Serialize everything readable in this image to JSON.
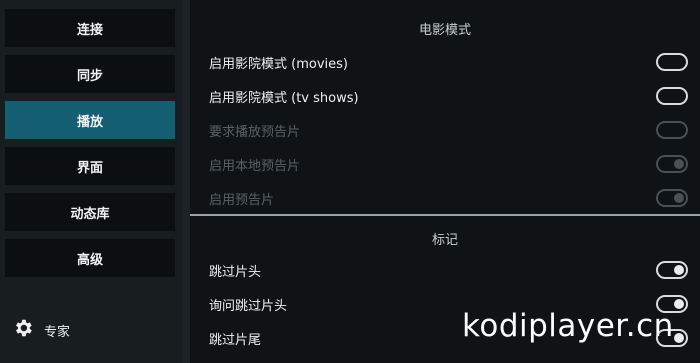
{
  "sidebar": {
    "items": [
      {
        "label": "连接",
        "active": false
      },
      {
        "label": "同步",
        "active": false
      },
      {
        "label": "播放",
        "active": true
      },
      {
        "label": "界面",
        "active": false
      },
      {
        "label": "动态库",
        "active": false
      },
      {
        "label": "高级",
        "active": false
      }
    ],
    "expert_label": "专家"
  },
  "sections": [
    {
      "title": "电影模式",
      "rows": [
        {
          "label": "启用影院模式 (movies)",
          "state": "off",
          "enabled": true
        },
        {
          "label": "启用影院模式 (tv shows)",
          "state": "off",
          "enabled": true
        },
        {
          "label": "要求播放预告片",
          "state": "off",
          "enabled": false
        },
        {
          "label": "启用本地预告片",
          "state": "on",
          "enabled": false
        },
        {
          "label": "启用预告片",
          "state": "on",
          "enabled": false
        }
      ]
    },
    {
      "title": "标记",
      "rows": [
        {
          "label": "跳过片头",
          "state": "on",
          "enabled": true
        },
        {
          "label": "询问跳过片头",
          "state": "on",
          "enabled": true
        },
        {
          "label": "跳过片尾",
          "state": "on",
          "enabled": true
        }
      ]
    }
  ],
  "watermark": "kodiplayer.cn",
  "colors": {
    "accent": "#155f73",
    "panel": "#0f1315",
    "sidebar_button": "#0c0f11"
  },
  "icons": {
    "expert": "gear-icon"
  }
}
